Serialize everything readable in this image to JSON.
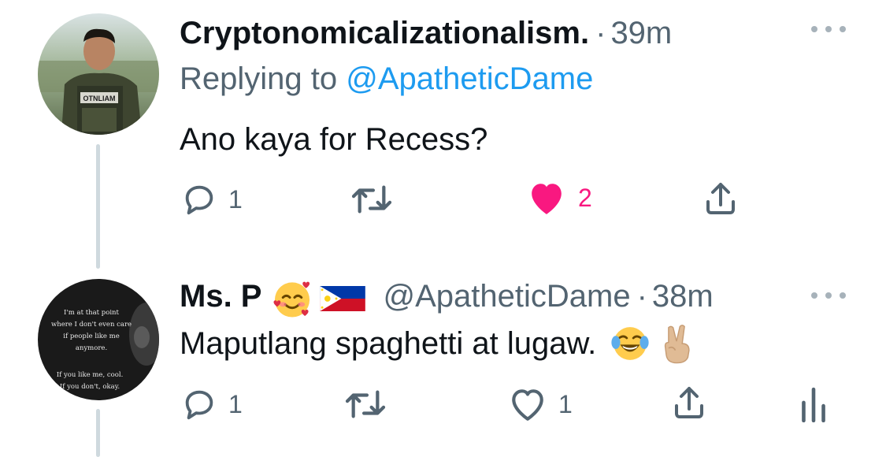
{
  "tweets": [
    {
      "name": "Cryptonomicalizationalism.",
      "handle": "",
      "dot": "·",
      "time": "39m",
      "replying_label": "Replying to",
      "replying_handle": "@ApatheticDame",
      "text": "Ano kaya for Recess?",
      "avatar_name_tag": "OTNLIAM",
      "actions": {
        "replies": "1",
        "retweets": "",
        "likes": "2",
        "liked": true
      },
      "colors": {
        "like": "#f91880"
      }
    },
    {
      "name": "Ms. P",
      "name_emojis": [
        "smiling-face-with-hearts",
        "philippines-flag"
      ],
      "handle": "@ApatheticDame",
      "dot": "·",
      "time": "38m",
      "text": "Maputlang spaghetti at lugaw.",
      "text_emojis": [
        "face-with-tears-of-joy",
        "victory-hand"
      ],
      "avatar_quote": {
        "line1": "I'm at that point",
        "line2": "where I don't even care",
        "line3": "if people like me",
        "line4": "anymore.",
        "line5": "If you like me, cool.",
        "line6": "If you don't, okay."
      },
      "actions": {
        "replies": "1",
        "retweets": "",
        "likes": "1",
        "liked": false
      }
    }
  ],
  "colors": {
    "muted": "#536471",
    "link": "#1d9bf0",
    "thread": "#cfd9de",
    "text": "#0f1419"
  }
}
